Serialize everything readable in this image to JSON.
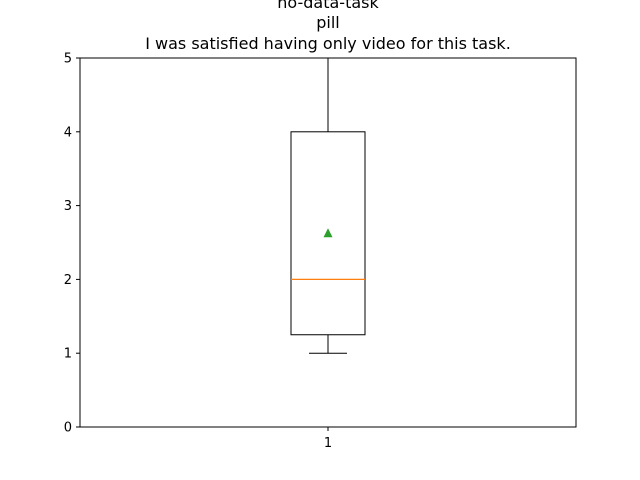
{
  "chart_data": {
    "type": "box",
    "title_lines": [
      "no-data-task",
      "pill",
      "I was satisfied having only video for this task."
    ],
    "xlabel": "",
    "ylabel": "",
    "categories": [
      "1"
    ],
    "ylim": [
      0,
      5
    ],
    "yticks": [
      "0",
      "1",
      "2",
      "3",
      "4",
      "5"
    ],
    "boxes": [
      {
        "whisker_low": 1.0,
        "q1": 1.25,
        "median": 2.0,
        "q3": 4.0,
        "whisker_high": 5.0,
        "mean": 2.625
      }
    ],
    "grid": false,
    "colors": {
      "box": "#000000",
      "median": "#ff7f0e",
      "mean": "#2ca02c",
      "axes": "#000000"
    }
  }
}
